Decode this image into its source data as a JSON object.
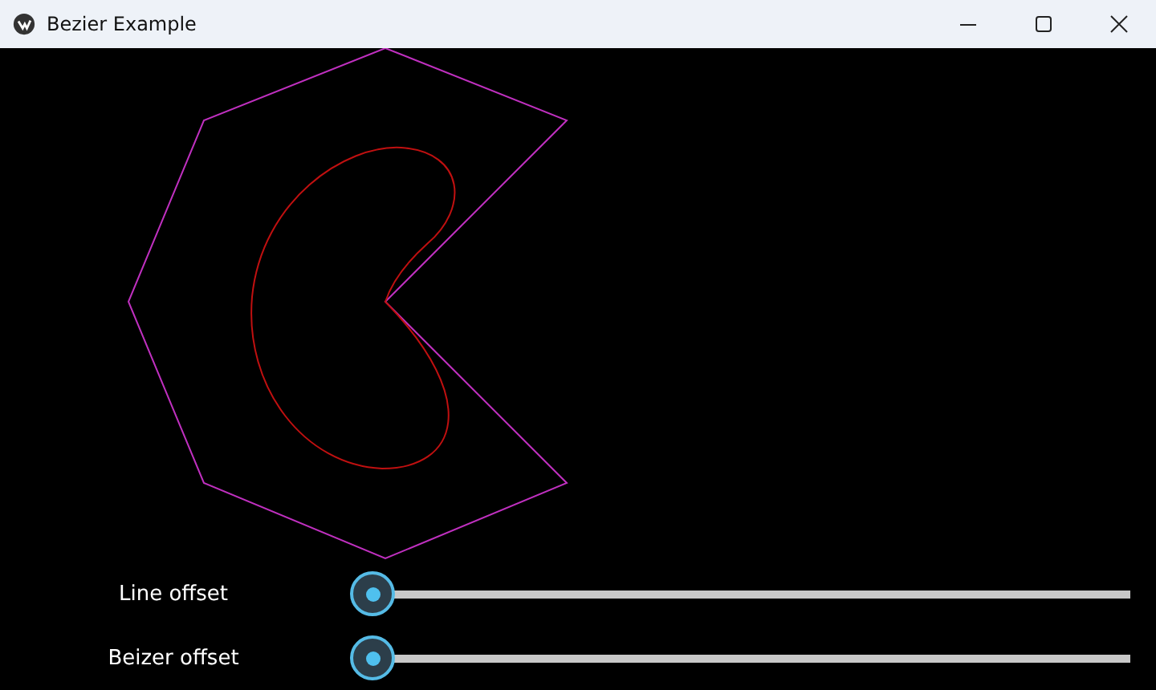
{
  "window": {
    "title": "Bezier Example"
  },
  "sliders": [
    {
      "label": "Line offset",
      "level": 0
    },
    {
      "label": "Beizer offset",
      "level": 0
    }
  ]
}
